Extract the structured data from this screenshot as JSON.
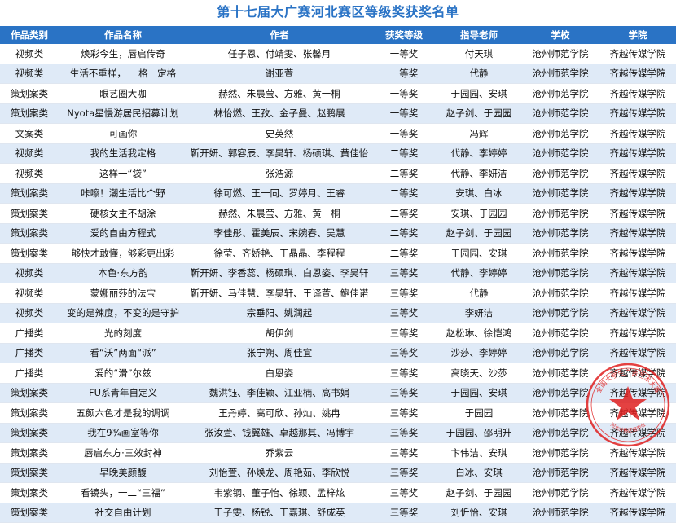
{
  "title": "第十七届大广赛河北赛区等级奖获奖名单",
  "headers": [
    "作品类别",
    "作品名称",
    "作者",
    "获奖等级",
    "指导老师",
    "学校",
    "学院"
  ],
  "rows": [
    [
      "视频类",
      "焕彩今生，唇启传奇",
      "任子恩、付靖雯、张馨月",
      "一等奖",
      "付天琪",
      "沧州师范学院",
      "齐越传媒学院"
    ],
    [
      "视频类",
      "生活不重样，   一格一定格",
      "谢亚萱",
      "一等奖",
      "代静",
      "沧州师范学院",
      "齐越传媒学院"
    ],
    [
      "策划案类",
      "眼艺圈大咖",
      "赫然、朱晨莹、方雅、黄一桐",
      "一等奖",
      "于园园、安琪",
      "沧州师范学院",
      "齐越传媒学院"
    ],
    [
      "策划案类",
      "Nyota星慢游居民招募计划",
      "林怡燃、王孜、金子曼、赵鹏展",
      "一等奖",
      "赵子剑、于园园",
      "沧州师范学院",
      "齐越传媒学院"
    ],
    [
      "文案类",
      "可画你",
      "史英然",
      "一等奖",
      "冯辉",
      "沧州师范学院",
      "齐越传媒学院"
    ],
    [
      "视频类",
      "我的生活我定格",
      "靳开妍、郭容辰、李昊轩、杨硕琪、黄佳怡",
      "二等奖",
      "代静、李婷婷",
      "沧州师范学院",
      "齐越传媒学院"
    ],
    [
      "视频类",
      "这样一“袋”",
      "张浩源",
      "二等奖",
      "代静、李妍洁",
      "沧州师范学院",
      "齐越传媒学院"
    ],
    [
      "策划案类",
      "咔嚓！潮生活比个野",
      "徐可燃、王一同、罗婷月、王睿",
      "二等奖",
      "安琪、白冰",
      "沧州师范学院",
      "齐越传媒学院"
    ],
    [
      "策划案类",
      "硬核女主不胡涂",
      "赫然、朱晨莹、方雅、黄一桐",
      "二等奖",
      "安琪、于园园",
      "沧州师范学院",
      "齐越传媒学院"
    ],
    [
      "策划案类",
      "爱的自由方程式",
      "李佳彤、霍美辰、宋婉春、吴慧",
      "二等奖",
      "赵子剑、于园园",
      "沧州师范学院",
      "齐越传媒学院"
    ],
    [
      "策划案类",
      "够快才敢懂，够彩更出彩",
      "徐莹、齐娇艳、王晶晶、李程程",
      "二等奖",
      "于园园、安琪",
      "沧州师范学院",
      "齐越传媒学院"
    ],
    [
      "视频类",
      "本色·东方韵",
      "靳开妍、李香蕊、杨硕琪、白恩姿、李昊轩",
      "三等奖",
      "代静、李婷婷",
      "沧州师范学院",
      "齐越传媒学院"
    ],
    [
      "视频类",
      "蒙娜丽莎的法宝",
      "靳开妍、马佳慧、李昊轩、王译萱、鲍佳诺",
      "三等奖",
      "代静",
      "沧州师范学院",
      "齐越传媒学院"
    ],
    [
      "视频类",
      "变的是辣度，不变的是守护",
      "宗垂阳、姚润起",
      "三等奖",
      "李妍洁",
      "沧州师范学院",
      "齐越传媒学院"
    ],
    [
      "广播类",
      "光的刻度",
      "胡伊剑",
      "三等奖",
      "赵松琳、徐恺鸿",
      "沧州师范学院",
      "齐越传媒学院"
    ],
    [
      "广播类",
      "看“沃”两面“派”",
      "张宁朔、周佳宜",
      "三等奖",
      "沙莎、李婷婷",
      "沧州师范学院",
      "齐越传媒学院"
    ],
    [
      "广播类",
      "爱的“滑”尔兹",
      "白恩姿",
      "三等奖",
      "高晓天、沙莎",
      "沧州师范学院",
      "齐越传媒学院"
    ],
    [
      "策划案类",
      "FU系青年自定义",
      "魏洪钰、李佳颖、江亚楠、高书娟",
      "三等奖",
      "于园园、安琪",
      "沧州师范学院",
      "齐越传媒学院"
    ],
    [
      "策划案类",
      "五颜六色才是我的调调",
      "王丹婷、高可欣、孙灿、姚冉",
      "三等奖",
      "于园园",
      "沧州师范学院",
      "齐越传媒学院"
    ],
    [
      "策划案类",
      "我在9¾画室等你",
      "张汝萱、钱翼雄、卓越那其、冯博宇",
      "三等奖",
      "于园园、邵明升",
      "沧州师范学院",
      "齐越传媒学院"
    ],
    [
      "策划案类",
      "唇启东方·三效封神",
      "乔紫云",
      "三等奖",
      "卞伟洁、安琪",
      "沧州师范学院",
      "齐越传媒学院"
    ],
    [
      "策划案类",
      "早晚美颜馥",
      "刘怡萱、孙焕龙、周艳茹、李欣悦",
      "三等奖",
      "白冰、安琪",
      "沧州师范学院",
      "齐越传媒学院"
    ],
    [
      "策划案类",
      "看镜头，一二“三福”",
      "韦紫钢、董子怡、徐颖、孟梓炫",
      "三等奖",
      "赵子剑、于园园",
      "沧州师范学院",
      "齐越传媒学院"
    ],
    [
      "策划案类",
      "社交自由计划",
      "王子雯、杨锐、王嘉琪、舒成英",
      "三等奖",
      "刘忻怡、安琪",
      "沧州师范学院",
      "齐越传媒学院"
    ]
  ],
  "seal": {
    "text_top": "全国大学生广告艺术大赛",
    "text_bottom": "河北分赛区组委会"
  },
  "colors": {
    "accent": "#2a73c5",
    "stripe": "#dfeaf7",
    "seal": "#e02020"
  }
}
